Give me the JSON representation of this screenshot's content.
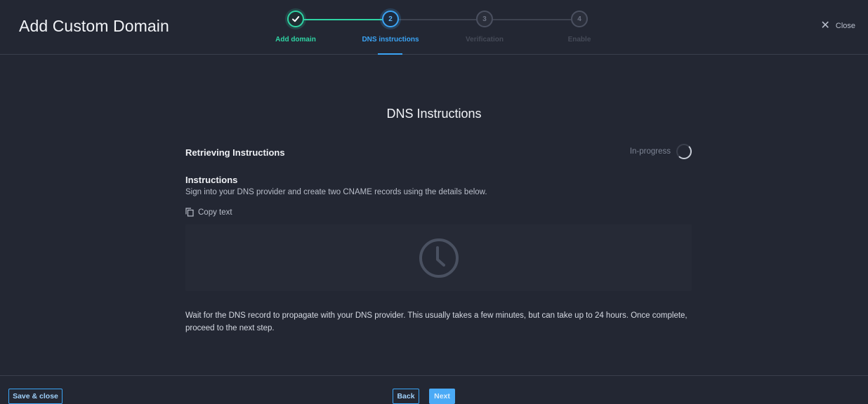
{
  "header": {
    "title": "Add Custom Domain",
    "close_label": "Close",
    "close_icon": "close-icon"
  },
  "stepper": {
    "steps": [
      {
        "number": "1",
        "label": "Add domain",
        "state": "complete",
        "color": "#2fd4a4"
      },
      {
        "number": "2",
        "label": "DNS instructions",
        "state": "active",
        "color": "#3ba4f5"
      },
      {
        "number": "3",
        "label": "Verification",
        "state": "pending",
        "color": "#4b5060"
      },
      {
        "number": "4",
        "label": "Enable",
        "state": "pending",
        "color": "#4b5060"
      }
    ]
  },
  "main": {
    "title": "DNS Instructions",
    "retrieving_title": "Retrieving Instructions",
    "status": "In-progress",
    "instructions_heading": "Instructions",
    "instructions_text": "Sign into your DNS provider and create two CNAME records using the details below.",
    "copy_label": "Copy text",
    "copy_icon": "copy-icon",
    "placeholder_icon": "clock-icon",
    "wait_text": "Wait for the DNS record to propagate with your DNS provider. This usually takes a few minutes, but can take up to 24 hours. Once complete, proceed to the next step."
  },
  "footer": {
    "save_close_label": "Save & close",
    "back_label": "Back",
    "next_label": "Next"
  },
  "colors": {
    "background": "#232733",
    "accent": "#3ba4f5",
    "success": "#2fd4a4"
  }
}
